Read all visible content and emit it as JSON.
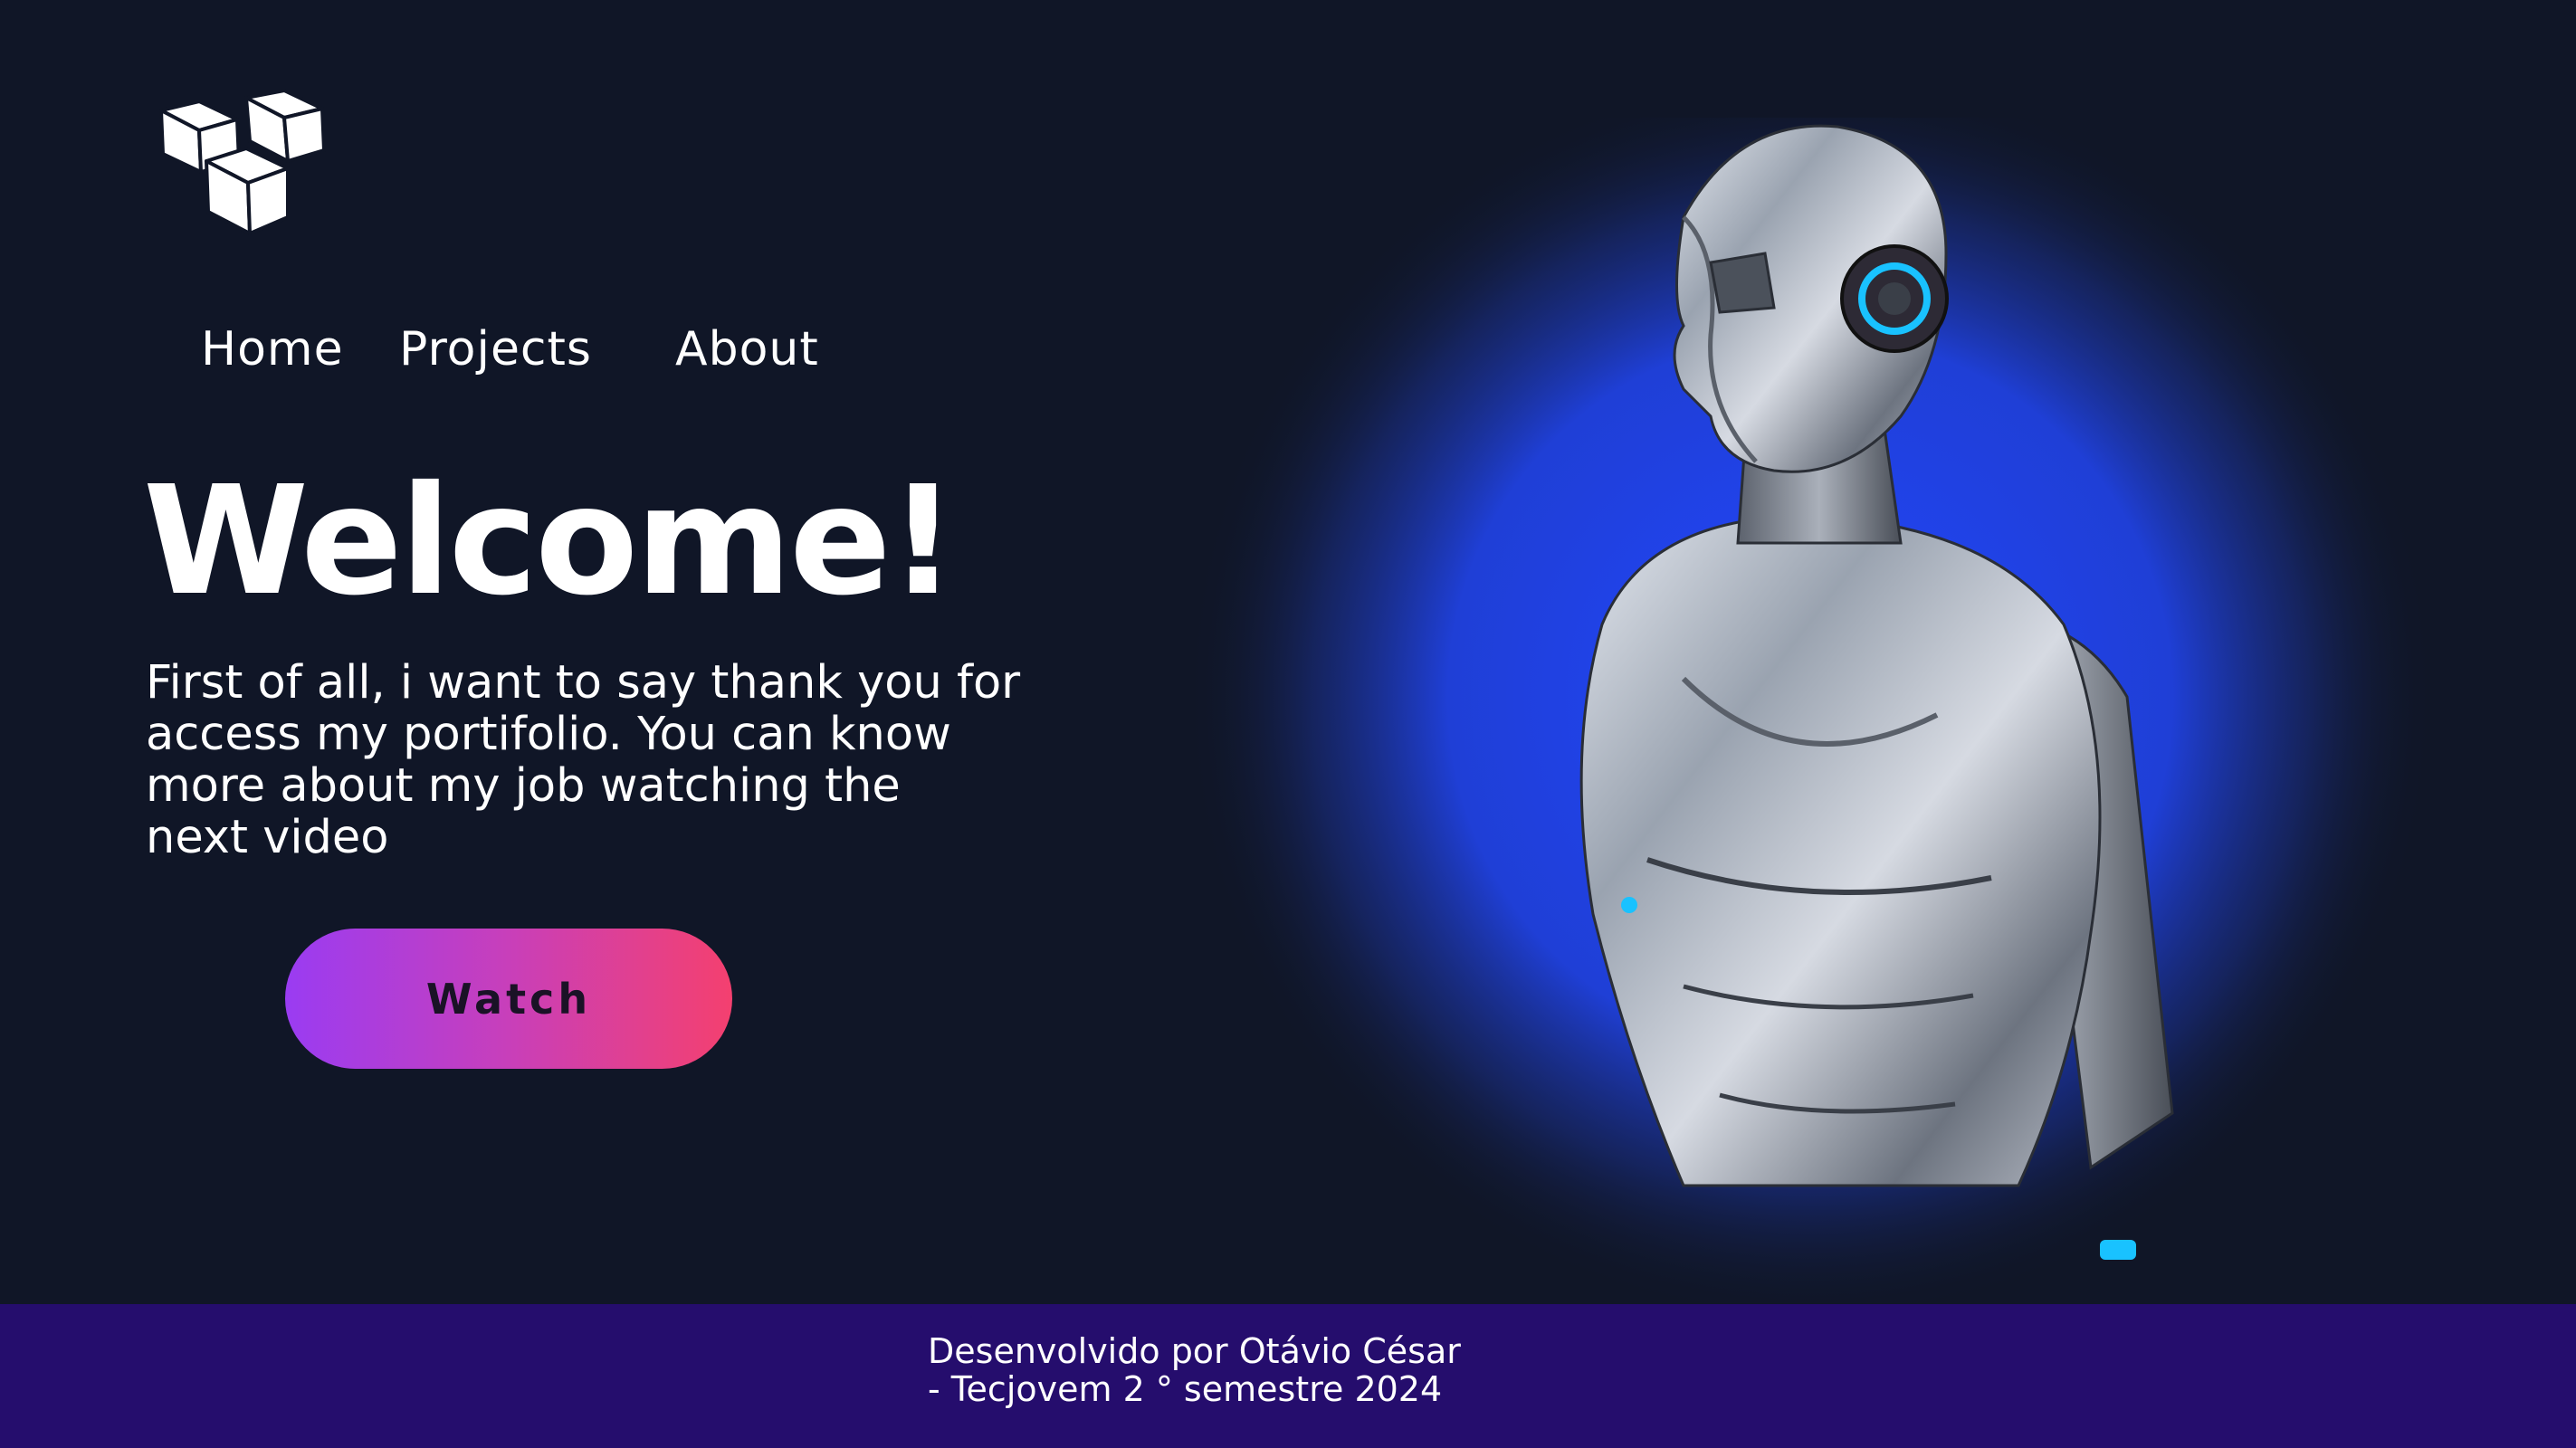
{
  "nav": {
    "home": "Home",
    "projects": "Projects",
    "about": "About"
  },
  "hero": {
    "title": "Welcome!",
    "intro_lines": [
      "First of all, i want to say thank you for",
      "access my portifolio. You can know",
      "more about my job watching  the",
      "next video"
    ],
    "watch_label": "Watch"
  },
  "footer": {
    "line1": "Desenvolvido por Otávio César",
    "line2": "- Tecjovem 2 ° semestre 2024"
  },
  "icons": {
    "logo": "cubes-logo-icon",
    "hero_image": "silver-humanoid-robot-illustration"
  },
  "colors": {
    "background": "#101627",
    "footer": "#250d6d",
    "glow": "#1f3fd6",
    "button_start": "#9a3cf2",
    "button_end": "#f4406f"
  }
}
